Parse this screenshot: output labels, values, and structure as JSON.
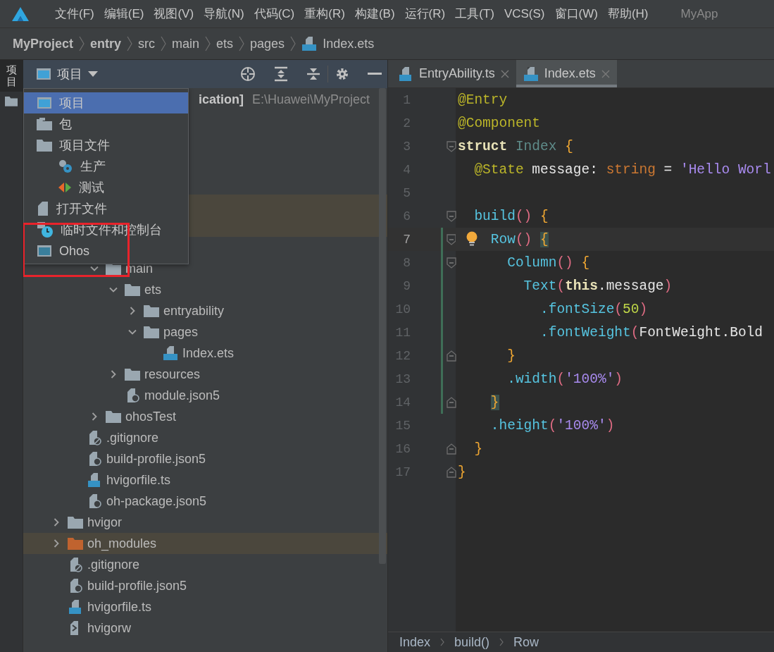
{
  "menu_bar": {
    "items": [
      "文件(F)",
      "编辑(E)",
      "视图(V)",
      "导航(N)",
      "代码(C)",
      "重构(R)",
      "构建(B)",
      "运行(R)",
      "工具(T)",
      "VCS(S)",
      "窗口(W)",
      "帮助(H)"
    ],
    "title": "MyApp"
  },
  "nav_bar": [
    {
      "label": "MyProject",
      "bold": true,
      "kind": "dir"
    },
    {
      "label": "entry",
      "bold": true,
      "kind": "dir"
    },
    {
      "label": "src",
      "bold": false,
      "kind": "dir"
    },
    {
      "label": "main",
      "bold": false,
      "kind": "dir"
    },
    {
      "label": "ets",
      "bold": false,
      "kind": "dir"
    },
    {
      "label": "pages",
      "bold": false,
      "kind": "dir"
    },
    {
      "label": "Index.ets",
      "bold": false,
      "kind": "ets"
    }
  ],
  "tool_strip": {
    "tabs": [
      {
        "label": "项目",
        "selected": true
      }
    ]
  },
  "project_panel": {
    "view_selector": "项目",
    "tree": [
      {
        "kind": "root",
        "label": "ication]",
        "path": "E:\\Huawei\\MyProject",
        "children": [
          {
            "kind": "covered"
          },
          {
            "kind": "covered"
          },
          {
            "kind": "covered"
          },
          {
            "kind": "covered"
          },
          {
            "highlighted": true
          },
          {
            "highlighted": true,
            "children": [
              {
                "children": [
                  {
                    "kind": "folder",
                    "label": "main",
                    "expanded": true,
                    "children": [
                      {
                        "kind": "folder",
                        "label": "ets",
                        "expanded": true,
                        "children": [
                          {
                            "kind": "folder",
                            "label": "entryability",
                            "expanded": false
                          },
                          {
                            "kind": "folder",
                            "label": "pages",
                            "expanded": true,
                            "children": [
                              {
                                "kind": "ets",
                                "label": "Index.ets"
                              }
                            ]
                          }
                        ]
                      },
                      {
                        "kind": "folder",
                        "label": "resources",
                        "expanded": false
                      },
                      {
                        "kind": "json",
                        "label": "module.json5"
                      }
                    ]
                  },
                  {
                    "kind": "folder",
                    "label": "ohosTest",
                    "expanded": false
                  }
                ]
              },
              {
                "kind": "ignore",
                "label": ".gitignore"
              },
              {
                "kind": "json",
                "label": "build-profile.json5"
              },
              {
                "kind": "ts",
                "label": "hvigorfile.ts"
              },
              {
                "kind": "json",
                "label": "oh-package.json5"
              }
            ]
          },
          {
            "kind": "folder",
            "label": "hvigor",
            "expanded": false
          },
          {
            "kind": "excluded",
            "label": "oh_modules",
            "expanded": false,
            "highlighted": true
          },
          {
            "kind": "ignore",
            "label": ".gitignore"
          },
          {
            "kind": "json",
            "label": "build-profile.json5"
          },
          {
            "kind": "ts",
            "label": "hvigorfile.ts"
          },
          {
            "kind": "script",
            "label": "hvigorw"
          }
        ]
      }
    ],
    "view_menu": [
      {
        "label": "项目",
        "kind": "window",
        "selected": true
      },
      {
        "label": "包",
        "kind": "package",
        "selected": false
      },
      {
        "label": "项目文件",
        "kind": "folder",
        "selected": false,
        "children": [
          {
            "label": "生产",
            "kind": "gears",
            "selected": false
          },
          {
            "label": "测试",
            "kind": "test",
            "selected": false
          }
        ]
      },
      {
        "label": "打开文件",
        "kind": "file",
        "selected": false
      },
      {
        "label": "临时文件和控制台",
        "kind": "scratch",
        "selected": false
      },
      {
        "label": "Ohos",
        "kind": "window",
        "selected": false,
        "annotated": true
      }
    ]
  },
  "editor": {
    "tabs": [
      {
        "label": "EntryAbility.ts",
        "kind": "ts",
        "selected": false
      },
      {
        "label": "Index.ets",
        "kind": "ets",
        "selected": true
      }
    ],
    "lines": [
      {
        "number": "1",
        "tokens": [
          {
            "text": "@Entry",
            "kind": "annotation"
          }
        ]
      },
      {
        "number": "2",
        "tokens": [
          {
            "text": "@Component",
            "kind": "annotation"
          }
        ]
      },
      {
        "number": "3",
        "kind": "fold_start",
        "tokens": [
          {
            "text": "struct",
            "kind": "keyword"
          },
          {
            "text": " Index",
            "kind": "type"
          },
          {
            "text": " {",
            "kind": "brace"
          }
        ],
        "children": [
          {
            "number": "4",
            "tokens": [
              {
                "text": "@State",
                "kind": "annotation"
              },
              {
                "text": " message",
                "kind": "ident"
              },
              {
                "text": ":",
                "kind": "punct"
              },
              {
                "text": " string",
                "kind": "builtin"
              },
              {
                "text": " =",
                "kind": "punct"
              },
              {
                "text": " 'Hello Worl",
                "kind": "string"
              }
            ]
          },
          {
            "number": "5"
          },
          {
            "number": "6",
            "kind": "fold_start",
            "tokens": [
              {
                "text": "build",
                "kind": "method"
              },
              {
                "text": "()",
                "kind": "paren"
              },
              {
                "text": " {",
                "kind": "brace"
              }
            ],
            "children": [
              {
                "number": "7",
                "kind": "fold_start",
                "current": true,
                "changed": true,
                "hint": true,
                "tokens": [
                  {
                    "text": "Row",
                    "kind": "method"
                  },
                  {
                    "text": "() ",
                    "kind": "paren"
                  },
                  {
                    "text": "{",
                    "kind": "brace",
                    "matched": true
                  }
                ],
                "children": [
                  {
                    "number": "8",
                    "kind": "fold_start",
                    "changed": true,
                    "tokens": [
                      {
                        "text": "Column",
                        "kind": "method"
                      },
                      {
                        "text": "()",
                        "kind": "paren"
                      },
                      {
                        "text": " {",
                        "kind": "brace"
                      }
                    ],
                    "children": [
                      {
                        "number": "9",
                        "changed": true,
                        "tokens": [
                          {
                            "text": "Text",
                            "kind": "method"
                          },
                          {
                            "text": "(",
                            "kind": "paren"
                          },
                          {
                            "text": "this",
                            "kind": "keyword"
                          },
                          {
                            "text": ".",
                            "kind": "punct"
                          },
                          {
                            "text": "message",
                            "kind": "ident"
                          },
                          {
                            "text": ")",
                            "kind": "paren"
                          }
                        ],
                        "children": [
                          {
                            "number": "10",
                            "changed": true,
                            "tokens": [
                              {
                                "text": ".fontSize",
                                "kind": "method"
                              },
                              {
                                "text": "(",
                                "kind": "paren"
                              },
                              {
                                "text": "50",
                                "kind": "number"
                              },
                              {
                                "text": ")",
                                "kind": "paren"
                              }
                            ]
                          },
                          {
                            "number": "11",
                            "changed": true,
                            "tokens": [
                              {
                                "text": ".fontWeight",
                                "kind": "method"
                              },
                              {
                                "text": "(",
                                "kind": "paren"
                              },
                              {
                                "text": "FontWeight.Bold",
                                "kind": "ident"
                              }
                            ]
                          }
                        ]
                      }
                    ]
                  },
                  {
                    "number": "12",
                    "kind": "fold_end",
                    "changed": true,
                    "tokens": [
                      {
                        "text": "}",
                        "kind": "brace"
                      }
                    ]
                  },
                  {
                    "number": "13",
                    "changed": true,
                    "tokens": [
                      {
                        "text": ".width",
                        "kind": "method"
                      },
                      {
                        "text": "(",
                        "kind": "paren"
                      },
                      {
                        "text": "'100%'",
                        "kind": "string"
                      },
                      {
                        "text": ")",
                        "kind": "paren"
                      }
                    ]
                  }
                ]
              },
              {
                "number": "14",
                "kind": "fold_end",
                "changed": true,
                "tokens": [
                  {
                    "text": "}",
                    "kind": "brace",
                    "matched": true
                  }
                ]
              },
              {
                "number": "15",
                "tokens": [
                  {
                    "text": ".height",
                    "kind": "method"
                  },
                  {
                    "text": "(",
                    "kind": "paren"
                  },
                  {
                    "text": "'100%'",
                    "kind": "string"
                  },
                  {
                    "text": ")",
                    "kind": "paren"
                  }
                ]
              }
            ]
          },
          {
            "number": "16",
            "kind": "fold_end",
            "tokens": [
              {
                "text": "}",
                "kind": "brace"
              }
            ]
          }
        ]
      },
      {
        "number": "17",
        "kind": "fold_end",
        "tokens": [
          {
            "text": "}",
            "kind": "brace"
          }
        ]
      }
    ],
    "breadcrumb": [
      "Index",
      "build()",
      "Row"
    ]
  }
}
